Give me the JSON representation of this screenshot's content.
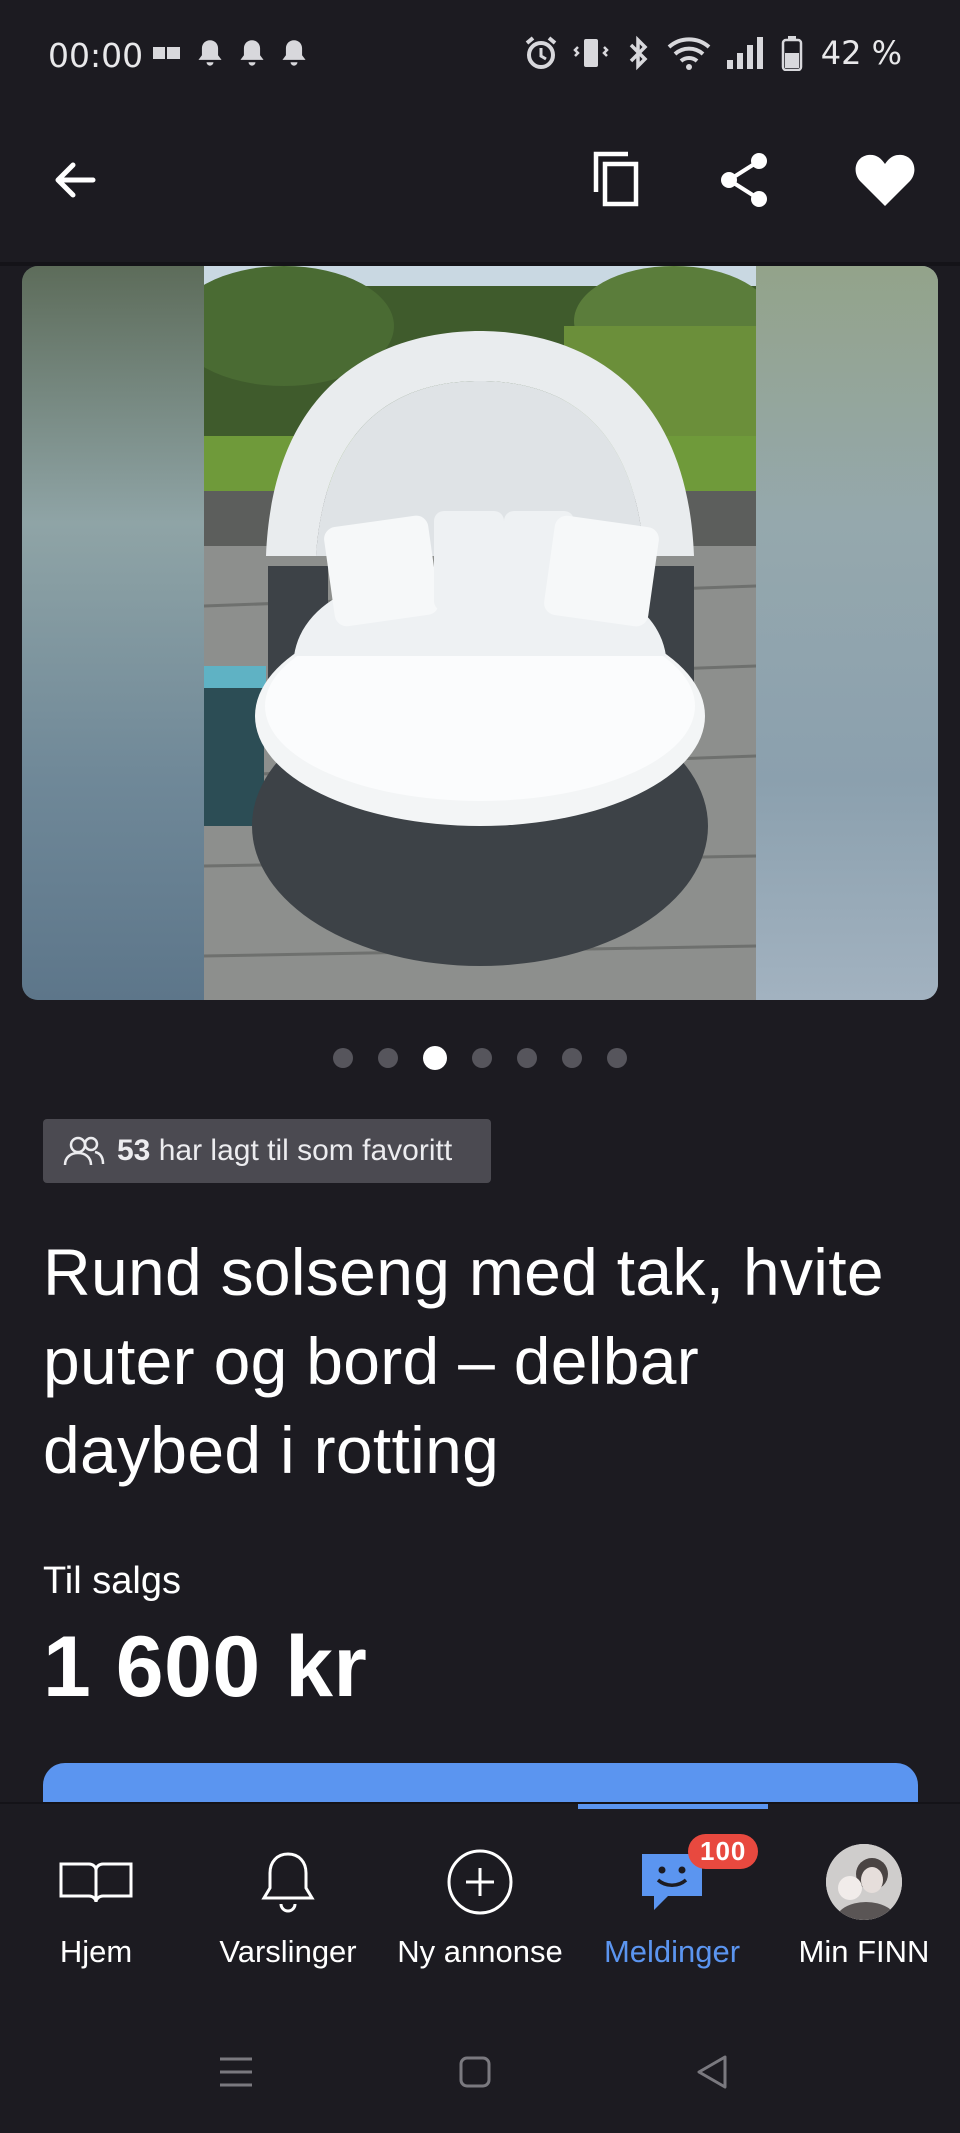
{
  "status_bar": {
    "time": "00:00",
    "battery_text": "42 %",
    "icons": [
      "sim-icon",
      "bell-icon",
      "bell-icon",
      "bell-icon",
      "alarm-icon",
      "vibrate-icon",
      "bluetooth-icon",
      "wifi-icon",
      "signal-icon",
      "battery-icon"
    ]
  },
  "app_bar": {
    "icons": [
      "back-arrow-icon",
      "copy-icon",
      "share-icon",
      "heart-icon"
    ]
  },
  "gallery": {
    "image_count": 7,
    "active_index": 3
  },
  "favorites": {
    "count": "53",
    "text": "har lagt til som favoritt"
  },
  "listing": {
    "title": "Rund solseng med tak, hvite puter og bord – delbar daybed i rotting",
    "sale_label": "Til salgs",
    "price": "1 600 kr"
  },
  "bottom_nav": {
    "items": [
      {
        "label": "Hjem",
        "icon": "book-icon"
      },
      {
        "label": "Varslinger",
        "icon": "bell-icon"
      },
      {
        "label": "Ny annonse",
        "icon": "plus-circle-icon"
      },
      {
        "label": "Meldinger",
        "icon": "chat-icon",
        "badge": "100"
      },
      {
        "label": "Min FINN",
        "icon": "avatar"
      }
    ],
    "active_index": 3
  },
  "colors": {
    "background": "#1c1b21",
    "accent": "#5b95f0",
    "badge_red": "#e8493f",
    "chip_bg": "#4b4a51"
  }
}
